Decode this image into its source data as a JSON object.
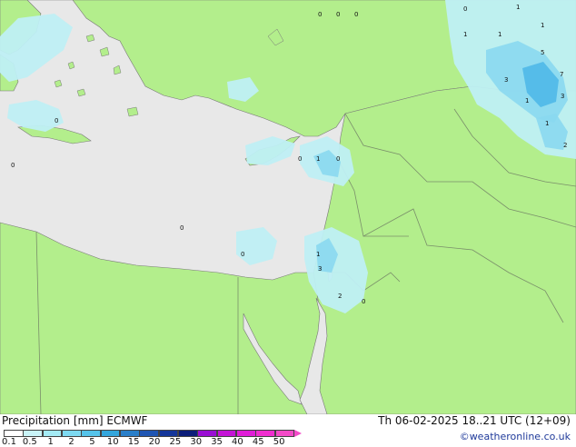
{
  "map": {
    "colors": {
      "sea": "#e8e8e8",
      "land": "#b3ee8c",
      "coast": "#777777",
      "border": "#7a8f6a",
      "precip_light": "#bfeff4",
      "precip_medium": "#8ad8f0",
      "precip_heavy": "#4fb8e8"
    },
    "value_markers": [
      "0",
      "0",
      "0",
      "0",
      "1",
      "1",
      "3",
      "1",
      "5",
      "7",
      "1",
      "3",
      "1",
      "2",
      "0",
      "0",
      "0",
      "1",
      "0",
      "0",
      "0",
      "1",
      "3",
      "2",
      "1",
      "0"
    ]
  },
  "footer": {
    "title": "Precipitation [mm] ECMWF",
    "run_info": "Th 06-02-2025 18..21 UTC (12+09)",
    "credit": "©weatheronline.co.uk",
    "legend": {
      "ticks": [
        "0.1",
        "0.5",
        "1",
        "2",
        "5",
        "10",
        "15",
        "20",
        "25",
        "30",
        "35",
        "40",
        "45",
        "50"
      ],
      "colors": [
        "#ffffff",
        "#c9f4f8",
        "#a4ebf5",
        "#7dd9f1",
        "#55c3ea",
        "#34a6dc",
        "#2a7fc9",
        "#2056b3",
        "#14369a",
        "#0c1e7a",
        "#9a0fd4",
        "#c414d6",
        "#e01ed8",
        "#f02ed0",
        "#f34ac8"
      ]
    }
  }
}
